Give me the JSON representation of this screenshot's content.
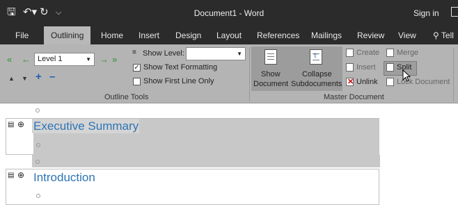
{
  "titlebar": {
    "save_icon": "save-icon",
    "undo_icon": "undo-icon",
    "redo_icon": "redo-icon",
    "qat_icon": "customize-quick-access-icon",
    "document_title": "Document1 - Word",
    "sign_in": "Sign in"
  },
  "tabs": [
    {
      "label": "File"
    },
    {
      "label": "Outlining"
    },
    {
      "label": "Home"
    },
    {
      "label": "Insert"
    },
    {
      "label": "Design"
    },
    {
      "label": "Layout"
    },
    {
      "label": "References"
    },
    {
      "label": "Mailings"
    },
    {
      "label": "Review"
    },
    {
      "label": "View"
    }
  ],
  "tell_me": "Tell",
  "outline_tools": {
    "group_label": "Outline Tools",
    "level_value": "Level 1",
    "show_level_label": "Show Level:",
    "show_level_value": "",
    "show_text_formatting": "Show Text Formatting",
    "show_text_formatting_checked": true,
    "show_first_line_only": "Show First Line Only",
    "show_first_line_only_checked": false
  },
  "master_document": {
    "group_label": "Master Document",
    "show_document_line1": "Show",
    "show_document_line2": "Document",
    "collapse_line1": "Collapse",
    "collapse_line2": "Subdocuments",
    "create": "Create",
    "insert": "Insert",
    "unlink": "Unlink",
    "merge": "Merge",
    "split": "Split",
    "lock_document": "Lock Document"
  },
  "document": {
    "heading1": "Executive Summary",
    "heading2": "Introduction"
  },
  "colors": {
    "heading": "#2e74b5",
    "ribbon": "#b4b4b4",
    "titlebar": "#2b2b2b"
  }
}
